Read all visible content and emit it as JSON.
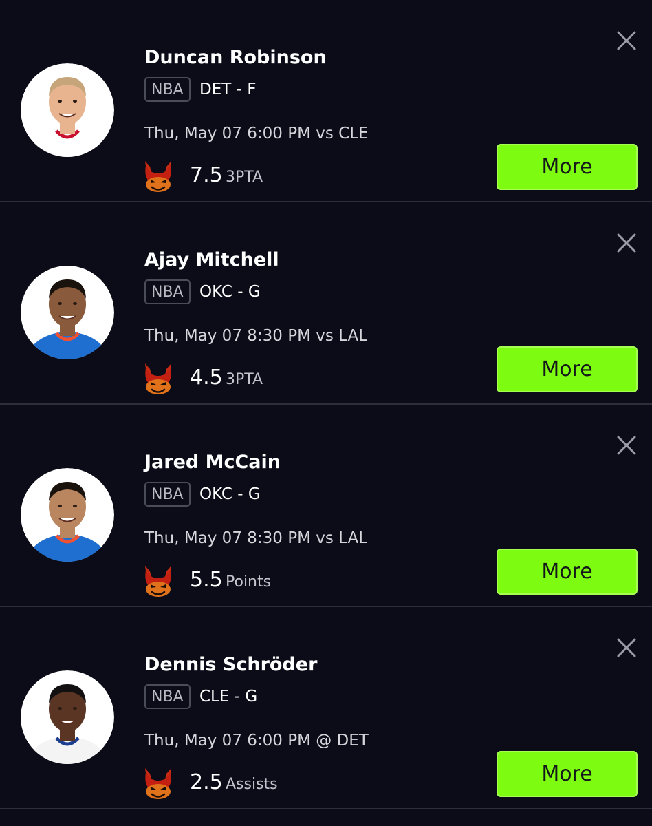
{
  "colors": {
    "background": "#0b0c17",
    "divider": "#2c2e3a",
    "more_button": "#7dfb10",
    "devil_icon": "#c9581e"
  },
  "icons": {
    "close": "close-icon",
    "devil": "devil-icon",
    "avatar": "player-headshot-avatar"
  },
  "players": [
    {
      "name": "Duncan Robinson",
      "league": "NBA",
      "team_pos": "DET - F",
      "game_time": "Thu, May 07 6:00 PM vs CLE",
      "line": "7.5",
      "stat": "3PTA",
      "more_label": "More",
      "jersey_color": "#ffffff",
      "trim_color": "#c8102e"
    },
    {
      "name": "Ajay Mitchell",
      "league": "NBA",
      "team_pos": "OKC - G",
      "game_time": "Thu, May 07 8:30 PM vs LAL",
      "line": "4.5",
      "stat": "3PTA",
      "more_label": "More",
      "jersey_color": "#1f6fd1",
      "trim_color": "#f05133"
    },
    {
      "name": "Jared McCain",
      "league": "NBA",
      "team_pos": "OKC - G",
      "game_time": "Thu, May 07 8:30 PM vs LAL",
      "line": "5.5",
      "stat": "Points",
      "more_label": "More",
      "jersey_color": "#1f6fd1",
      "trim_color": "#f05133"
    },
    {
      "name": "Dennis Schröder",
      "league": "NBA",
      "team_pos": "CLE - G",
      "game_time": "Thu, May 07 6:00 PM @ DET",
      "line": "2.5",
      "stat": "Assists",
      "more_label": "More",
      "jersey_color": "#f4f4f4",
      "trim_color": "#1d3f8f"
    }
  ]
}
